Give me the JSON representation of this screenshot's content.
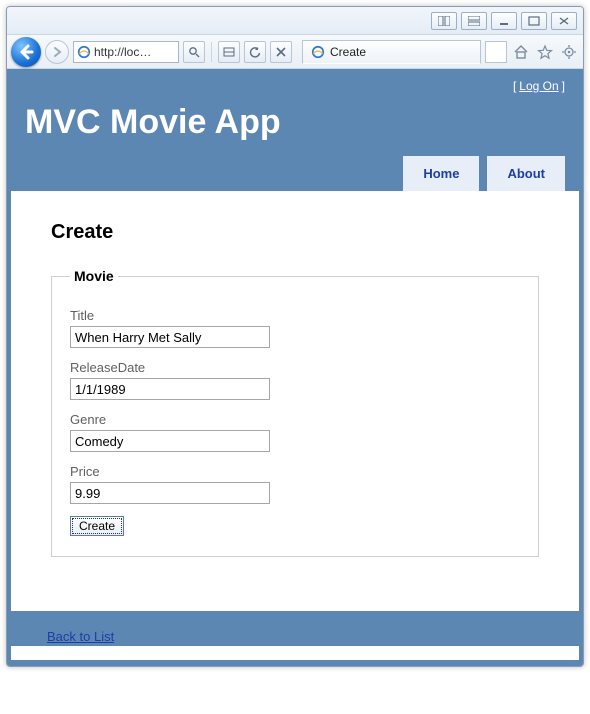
{
  "browser": {
    "url_display": "http://loc…",
    "tab_title": "Create"
  },
  "account": {
    "logon_label": "Log On"
  },
  "header": {
    "app_title": "MVC Movie App",
    "nav": [
      {
        "label": "Home"
      },
      {
        "label": "About"
      }
    ]
  },
  "page": {
    "heading": "Create",
    "fieldset_legend": "Movie",
    "fields": {
      "title": {
        "label": "Title",
        "value": "When Harry Met Sally"
      },
      "releaseDate": {
        "label": "ReleaseDate",
        "value": "1/1/1989"
      },
      "genre": {
        "label": "Genre",
        "value": "Comedy"
      },
      "price": {
        "label": "Price",
        "value": "9.99"
      }
    },
    "submit_label": "Create",
    "back_link_label": "Back to List"
  }
}
